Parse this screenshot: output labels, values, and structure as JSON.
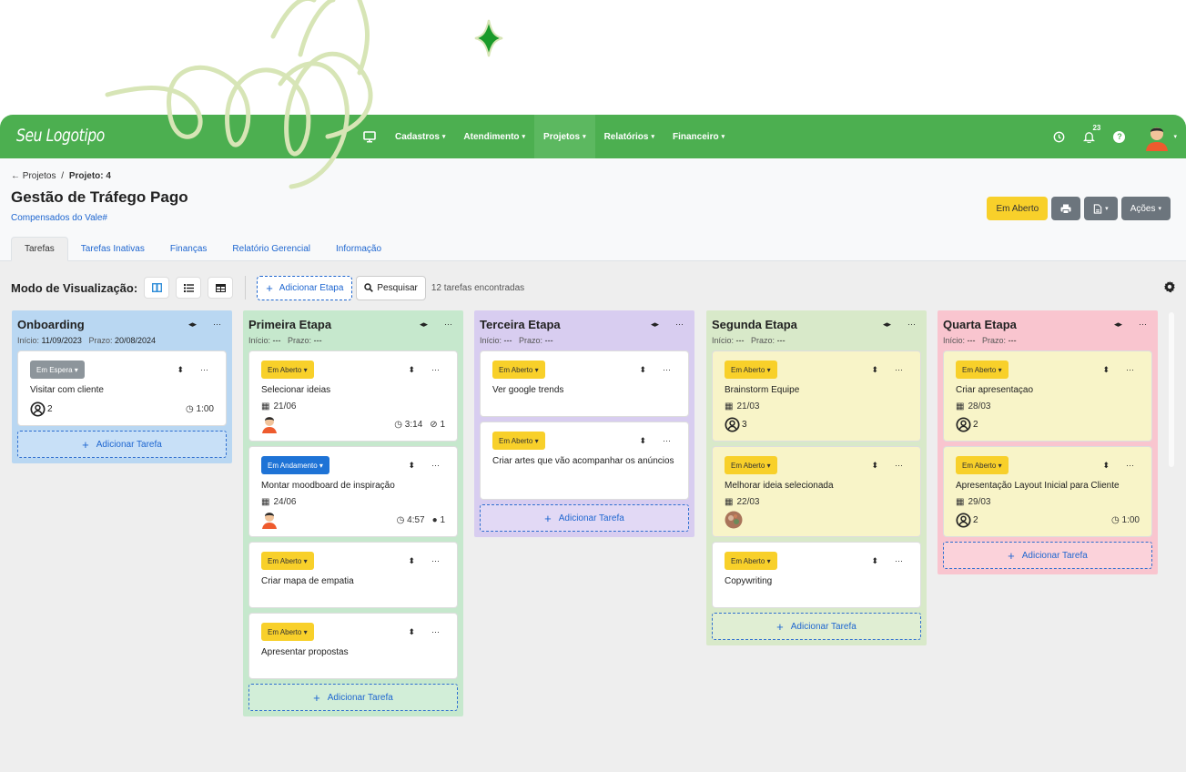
{
  "app": {
    "logo": "Seu Logotipo",
    "nav": [
      {
        "label": "Cadastros",
        "active": false
      },
      {
        "label": "Atendimento",
        "active": false
      },
      {
        "label": "Projetos",
        "active": true
      },
      {
        "label": "Relatórios",
        "active": false
      },
      {
        "label": "Financeiro",
        "active": false
      }
    ],
    "notification_count": "23",
    "icons": [
      "monitor-icon",
      "clock-icon",
      "bell-icon",
      "help-icon",
      "user-avatar"
    ]
  },
  "header": {
    "breadcrumb_back": "← Projetos",
    "breadcrumb_sep": "/",
    "breadcrumb_current": "Projeto: 4",
    "title": "Gestão de Tráfego Pago",
    "client": "Compensados do Vale#",
    "status_button": "Em Aberto",
    "actions_button": "Ações"
  },
  "tabs": [
    "Tarefas",
    "Tarefas Inativas",
    "Finanças",
    "Relatório Gerencial",
    "Informação"
  ],
  "toolbar": {
    "view_label": "Modo de Visualização:",
    "add_stage": "Adicionar Etapa",
    "search": "Pesquisar",
    "task_count": "12 tarefas encontradas"
  },
  "columns": [
    {
      "title": "Onboarding",
      "start_label": "Início:",
      "start": "11/09/2023",
      "deadline_label": "Prazo:",
      "deadline": "20/08/2024",
      "color": "#b9d7f2",
      "cards": [
        {
          "badge": "Em Espera",
          "badge_style": "gray",
          "title": "Visitar com cliente",
          "users": "2",
          "time": "1:00"
        }
      ],
      "add": "Adicionar Tarefa"
    },
    {
      "title": "Primeira Etapa",
      "start_label": "Início:",
      "start": "---",
      "deadline_label": "Prazo:",
      "deadline": "---",
      "color": "#c6e8cd",
      "cards": [
        {
          "badge": "Em Aberto",
          "badge_style": "yellow",
          "title": "Selecionar ideias",
          "date": "21/06",
          "avatar": "person",
          "time": "3:14",
          "attachments": "1"
        },
        {
          "badge": "Em Andamento",
          "badge_style": "blue",
          "title": "Montar moodboard de inspiração",
          "date": "24/06",
          "avatar": "person",
          "time": "4:57",
          "comments": "1"
        },
        {
          "badge": "Em Aberto",
          "badge_style": "yellow",
          "title": "Criar mapa de empatia"
        },
        {
          "badge": "Em Aberto",
          "badge_style": "yellow",
          "title": "Apresentar propostas"
        }
      ],
      "add": "Adicionar Tarefa"
    },
    {
      "title": "Terceira Etapa",
      "start_label": "Início:",
      "start": "---",
      "deadline_label": "Prazo:",
      "deadline": "---",
      "color": "#d8cdf0",
      "cards": [
        {
          "badge": "Em Aberto",
          "badge_style": "yellow",
          "title": "Ver google trends"
        },
        {
          "badge": "Em Aberto",
          "badge_style": "yellow",
          "title": "Criar artes que vão acompanhar os anúncios"
        }
      ],
      "add": "Adicionar Tarefa"
    },
    {
      "title": "Segunda Etapa",
      "start_label": "Início:",
      "start": "---",
      "deadline_label": "Prazo:",
      "deadline": "---",
      "color": "#d8e9c9",
      "cards": [
        {
          "badge": "Em Aberto",
          "badge_style": "yellow",
          "title": "Brainstorm Equipe",
          "date": "21/03",
          "users": "3",
          "bg": "#f8f4c8"
        },
        {
          "badge": "Em Aberto",
          "badge_style": "yellow",
          "title": "Melhorar ideia selecionada",
          "date": "22/03",
          "avatar": "photo",
          "bg": "#f8f4c8"
        },
        {
          "badge": "Em Aberto",
          "badge_style": "yellow",
          "title": "Copywriting"
        }
      ],
      "add": "Adicionar Tarefa"
    },
    {
      "title": "Quarta Etapa",
      "start_label": "Início:",
      "start": "---",
      "deadline_label": "Prazo:",
      "deadline": "---",
      "color": "#f9c5cf",
      "cards": [
        {
          "badge": "Em Aberto",
          "badge_style": "yellow",
          "title": "Criar apresentaçao",
          "date": "28/03",
          "users": "2",
          "bg": "#f8f4c8"
        },
        {
          "badge": "Em Aberto",
          "badge_style": "yellow",
          "title": "Apresentação Layout Inicial para Cliente",
          "date": "29/03",
          "users": "2",
          "time": "1:00",
          "bg": "#f8f4c8"
        }
      ],
      "add": "Adicionar Tarefa"
    }
  ]
}
